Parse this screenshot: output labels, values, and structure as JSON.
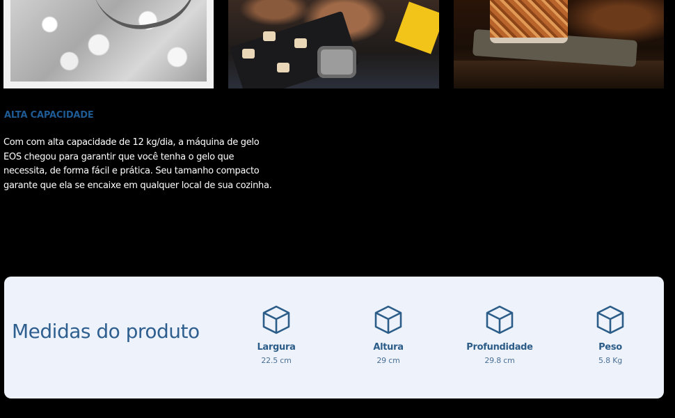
{
  "feature": {
    "title": "ALTA CAPACIDADE",
    "text": "Com com alta capacidade de 12 kg/dia, a máquina de gelo EOS chegou para garantir que você tenha o gelo que necessita, de forma fácil e prática. Seu tamanho compacto garante que ela se encaixe em qualquer local de sua cozinha."
  },
  "measures": {
    "title": "Medidas do produto",
    "icon": "cube-icon",
    "accent_color": "#2c5c88",
    "items": [
      {
        "label": "Largura",
        "value": "22.5 cm"
      },
      {
        "label": "Altura",
        "value": "29 cm"
      },
      {
        "label": "Profundidade",
        "value": "29.8 cm"
      },
      {
        "label": "Peso",
        "value": "5.8 Kg"
      }
    ]
  }
}
